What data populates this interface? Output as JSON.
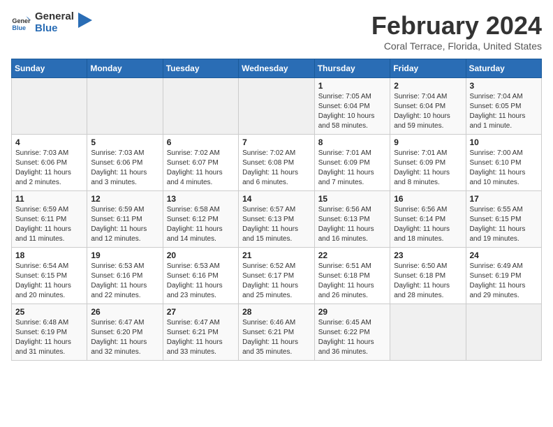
{
  "logo": {
    "text_general": "General",
    "text_blue": "Blue"
  },
  "header": {
    "month_year": "February 2024",
    "location": "Coral Terrace, Florida, United States"
  },
  "weekdays": [
    "Sunday",
    "Monday",
    "Tuesday",
    "Wednesday",
    "Thursday",
    "Friday",
    "Saturday"
  ],
  "weeks": [
    [
      {
        "day": "",
        "info": ""
      },
      {
        "day": "",
        "info": ""
      },
      {
        "day": "",
        "info": ""
      },
      {
        "day": "",
        "info": ""
      },
      {
        "day": "1",
        "info": "Sunrise: 7:05 AM\nSunset: 6:04 PM\nDaylight: 10 hours\nand 58 minutes."
      },
      {
        "day": "2",
        "info": "Sunrise: 7:04 AM\nSunset: 6:04 PM\nDaylight: 10 hours\nand 59 minutes."
      },
      {
        "day": "3",
        "info": "Sunrise: 7:04 AM\nSunset: 6:05 PM\nDaylight: 11 hours\nand 1 minute."
      }
    ],
    [
      {
        "day": "4",
        "info": "Sunrise: 7:03 AM\nSunset: 6:06 PM\nDaylight: 11 hours\nand 2 minutes."
      },
      {
        "day": "5",
        "info": "Sunrise: 7:03 AM\nSunset: 6:06 PM\nDaylight: 11 hours\nand 3 minutes."
      },
      {
        "day": "6",
        "info": "Sunrise: 7:02 AM\nSunset: 6:07 PM\nDaylight: 11 hours\nand 4 minutes."
      },
      {
        "day": "7",
        "info": "Sunrise: 7:02 AM\nSunset: 6:08 PM\nDaylight: 11 hours\nand 6 minutes."
      },
      {
        "day": "8",
        "info": "Sunrise: 7:01 AM\nSunset: 6:09 PM\nDaylight: 11 hours\nand 7 minutes."
      },
      {
        "day": "9",
        "info": "Sunrise: 7:01 AM\nSunset: 6:09 PM\nDaylight: 11 hours\nand 8 minutes."
      },
      {
        "day": "10",
        "info": "Sunrise: 7:00 AM\nSunset: 6:10 PM\nDaylight: 11 hours\nand 10 minutes."
      }
    ],
    [
      {
        "day": "11",
        "info": "Sunrise: 6:59 AM\nSunset: 6:11 PM\nDaylight: 11 hours\nand 11 minutes."
      },
      {
        "day": "12",
        "info": "Sunrise: 6:59 AM\nSunset: 6:11 PM\nDaylight: 11 hours\nand 12 minutes."
      },
      {
        "day": "13",
        "info": "Sunrise: 6:58 AM\nSunset: 6:12 PM\nDaylight: 11 hours\nand 14 minutes."
      },
      {
        "day": "14",
        "info": "Sunrise: 6:57 AM\nSunset: 6:13 PM\nDaylight: 11 hours\nand 15 minutes."
      },
      {
        "day": "15",
        "info": "Sunrise: 6:56 AM\nSunset: 6:13 PM\nDaylight: 11 hours\nand 16 minutes."
      },
      {
        "day": "16",
        "info": "Sunrise: 6:56 AM\nSunset: 6:14 PM\nDaylight: 11 hours\nand 18 minutes."
      },
      {
        "day": "17",
        "info": "Sunrise: 6:55 AM\nSunset: 6:15 PM\nDaylight: 11 hours\nand 19 minutes."
      }
    ],
    [
      {
        "day": "18",
        "info": "Sunrise: 6:54 AM\nSunset: 6:15 PM\nDaylight: 11 hours\nand 20 minutes."
      },
      {
        "day": "19",
        "info": "Sunrise: 6:53 AM\nSunset: 6:16 PM\nDaylight: 11 hours\nand 22 minutes."
      },
      {
        "day": "20",
        "info": "Sunrise: 6:53 AM\nSunset: 6:16 PM\nDaylight: 11 hours\nand 23 minutes."
      },
      {
        "day": "21",
        "info": "Sunrise: 6:52 AM\nSunset: 6:17 PM\nDaylight: 11 hours\nand 25 minutes."
      },
      {
        "day": "22",
        "info": "Sunrise: 6:51 AM\nSunset: 6:18 PM\nDaylight: 11 hours\nand 26 minutes."
      },
      {
        "day": "23",
        "info": "Sunrise: 6:50 AM\nSunset: 6:18 PM\nDaylight: 11 hours\nand 28 minutes."
      },
      {
        "day": "24",
        "info": "Sunrise: 6:49 AM\nSunset: 6:19 PM\nDaylight: 11 hours\nand 29 minutes."
      }
    ],
    [
      {
        "day": "25",
        "info": "Sunrise: 6:48 AM\nSunset: 6:19 PM\nDaylight: 11 hours\nand 31 minutes."
      },
      {
        "day": "26",
        "info": "Sunrise: 6:47 AM\nSunset: 6:20 PM\nDaylight: 11 hours\nand 32 minutes."
      },
      {
        "day": "27",
        "info": "Sunrise: 6:47 AM\nSunset: 6:21 PM\nDaylight: 11 hours\nand 33 minutes."
      },
      {
        "day": "28",
        "info": "Sunrise: 6:46 AM\nSunset: 6:21 PM\nDaylight: 11 hours\nand 35 minutes."
      },
      {
        "day": "29",
        "info": "Sunrise: 6:45 AM\nSunset: 6:22 PM\nDaylight: 11 hours\nand 36 minutes."
      },
      {
        "day": "",
        "info": ""
      },
      {
        "day": "",
        "info": ""
      }
    ]
  ]
}
